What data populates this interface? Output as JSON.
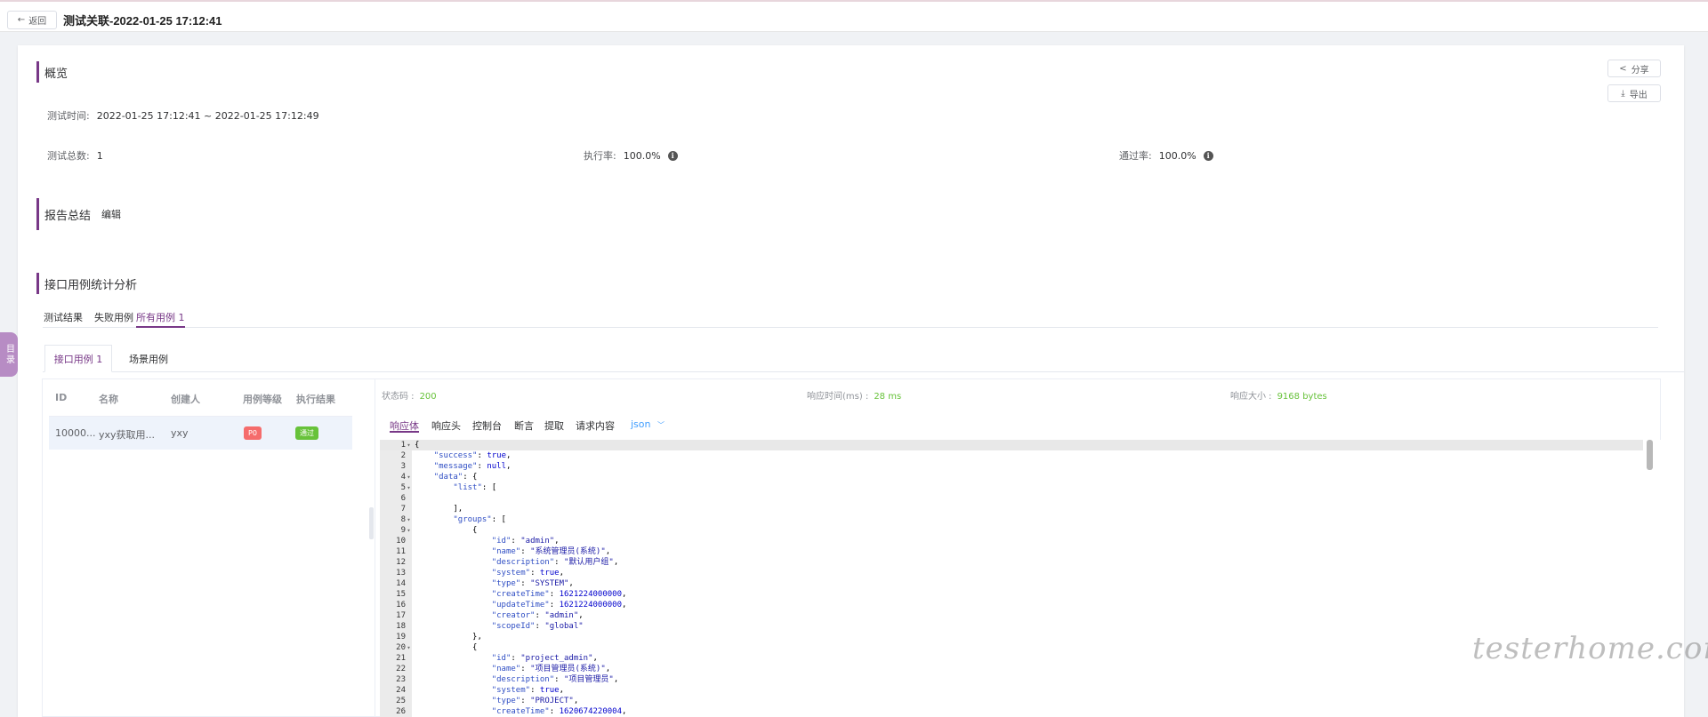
{
  "header": {
    "back_label": "返回",
    "title": "测试关联-2022-01-25 17:12:41"
  },
  "overview": {
    "title": "概览",
    "share_label": "分享",
    "export_label": "导出",
    "test_time_label": "测试时间:",
    "test_time_value": "2022-01-25 17:12:41 ~ 2022-01-25 17:12:49",
    "total_label": "测试总数:",
    "total_value": "1",
    "exec_rate_label": "执行率:",
    "exec_rate_value": "100.0%",
    "pass_rate_label": "通过率:",
    "pass_rate_value": "100.0%"
  },
  "summary": {
    "title": "报告总结",
    "edit_label": "编辑"
  },
  "analysis": {
    "title": "接口用例统计分析"
  },
  "result_tabs": [
    {
      "label": "测试结果"
    },
    {
      "label": "失败用例"
    },
    {
      "label": "所有用例  1"
    }
  ],
  "case_tabs": [
    {
      "label": "接口用例  1"
    },
    {
      "label": "场景用例"
    }
  ],
  "table": {
    "headers": [
      "ID",
      "名称",
      "创建人",
      "用例等级",
      "执行结果"
    ],
    "rows": [
      {
        "id": "10000...",
        "name": "yxy获取用...",
        "creator": "yxy",
        "level": "P0",
        "result": "通过"
      }
    ]
  },
  "response": {
    "status_label": "状态码 :",
    "status_value": "200",
    "time_label": "响应时间(ms) :",
    "time_value": "28 ms",
    "size_label": "响应大小 :",
    "size_value": "9168 bytes",
    "tabs": [
      "响应体",
      "响应头",
      "控制台",
      "断言",
      "提取",
      "请求内容"
    ],
    "format": "json"
  },
  "code_lines": [
    "{",
    "    \"success\": true,",
    "    \"message\": null,",
    "    \"data\": {",
    "        \"list\": [",
    "",
    "        ],",
    "        \"groups\": [",
    "            {",
    "                \"id\": \"admin\",",
    "                \"name\": \"系统管理员(系统)\",",
    "                \"description\": \"默认用户组\",",
    "                \"system\": true,",
    "                \"type\": \"SYSTEM\",",
    "                \"createTime\": 1621224000000,",
    "                \"updateTime\": 1621224000000,",
    "                \"creator\": \"admin\",",
    "                \"scopeId\": \"global\"",
    "            },",
    "            {",
    "                \"id\": \"project_admin\",",
    "                \"name\": \"项目管理员(系统)\",",
    "                \"description\": \"项目管理员\",",
    "                \"system\": true,",
    "                \"type\": \"PROJECT\",",
    "                \"createTime\": 1620674220004,"
  ],
  "side_label": "目录",
  "watermark": "testerhome.com",
  "colors": {
    "accent": "#783887",
    "success": "#67c23a",
    "danger": "#f56c6c",
    "link": "#409eff"
  }
}
